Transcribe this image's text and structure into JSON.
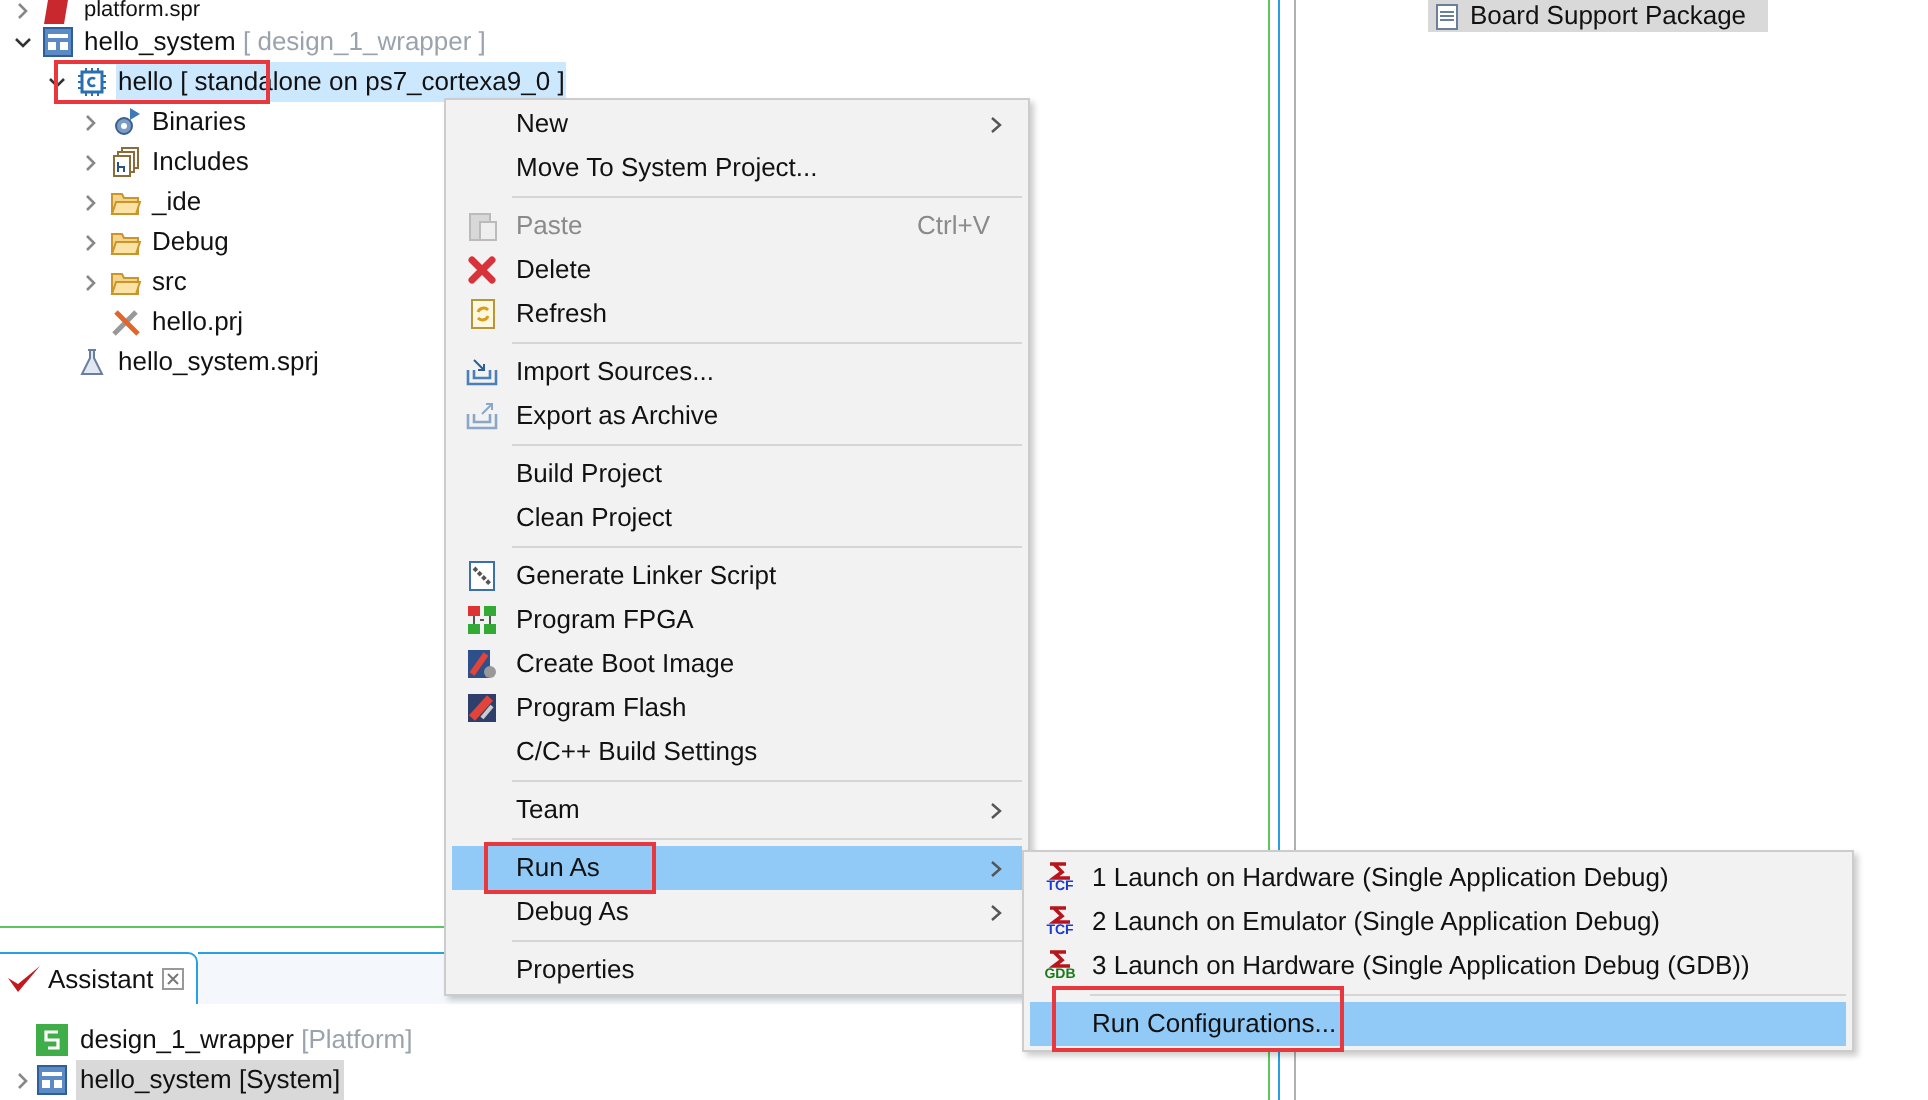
{
  "project_tree": [
    {
      "label": "platform.spr",
      "expanded": false,
      "selected": false,
      "highlighted": false
    },
    {
      "label": "hello_system",
      "suffix": "[ design_1_wrapper ]",
      "expanded": true,
      "selected": false,
      "highlighted": false,
      "children": [
        {
          "label": "hello [ standalone on ps7_cortexa9_0 ]",
          "expanded": true,
          "selected": true,
          "highlighted": true,
          "children": [
            {
              "label": "Binaries",
              "expanded": false,
              "selected": false,
              "highlighted": false
            },
            {
              "label": "Includes",
              "expanded": false,
              "selected": false,
              "highlighted": false
            },
            {
              "label": "_ide",
              "expanded": false,
              "selected": false,
              "highlighted": false
            },
            {
              "label": "Debug",
              "expanded": false,
              "selected": false,
              "highlighted": false
            },
            {
              "label": "src",
              "expanded": false,
              "selected": false,
              "highlighted": false
            },
            {
              "label": "hello.prj",
              "selected": false,
              "highlighted": false
            }
          ]
        },
        {
          "label": "hello_system.sprj",
          "selected": false,
          "highlighted": false
        }
      ]
    }
  ],
  "right_panel": {
    "item": "Board Support Package"
  },
  "context_menu": {
    "items": [
      {
        "kind": "item",
        "label": "New",
        "submenu": true,
        "disabled": false,
        "selected": false,
        "highlighted": false
      },
      {
        "kind": "item",
        "label": "Move To System Project...",
        "submenu": false,
        "disabled": false,
        "selected": false,
        "highlighted": false
      },
      {
        "kind": "separator"
      },
      {
        "kind": "item",
        "label": "Paste",
        "shortcut": "Ctrl+V",
        "submenu": false,
        "disabled": true,
        "selected": false,
        "highlighted": false
      },
      {
        "kind": "item",
        "label": "Delete",
        "submenu": false,
        "disabled": false,
        "selected": false,
        "highlighted": false
      },
      {
        "kind": "item",
        "label": "Refresh",
        "submenu": false,
        "disabled": false,
        "selected": false,
        "highlighted": false
      },
      {
        "kind": "separator"
      },
      {
        "kind": "item",
        "label": "Import Sources...",
        "submenu": false,
        "disabled": false,
        "selected": false,
        "highlighted": false
      },
      {
        "kind": "item",
        "label": "Export as Archive",
        "submenu": false,
        "disabled": false,
        "selected": false,
        "highlighted": false
      },
      {
        "kind": "separator"
      },
      {
        "kind": "item",
        "label": "Build Project",
        "submenu": false,
        "disabled": false,
        "selected": false,
        "highlighted": false
      },
      {
        "kind": "item",
        "label": "Clean Project",
        "submenu": false,
        "disabled": false,
        "selected": false,
        "highlighted": false
      },
      {
        "kind": "separator"
      },
      {
        "kind": "item",
        "label": "Generate Linker Script",
        "submenu": false,
        "disabled": false,
        "selected": false,
        "highlighted": false
      },
      {
        "kind": "item",
        "label": "Program FPGA",
        "submenu": false,
        "disabled": false,
        "selected": false,
        "highlighted": false
      },
      {
        "kind": "item",
        "label": "Create Boot Image",
        "submenu": false,
        "disabled": false,
        "selected": false,
        "highlighted": false
      },
      {
        "kind": "item",
        "label": "Program Flash",
        "submenu": false,
        "disabled": false,
        "selected": false,
        "highlighted": false
      },
      {
        "kind": "item",
        "label": "C/C++ Build Settings",
        "submenu": false,
        "disabled": false,
        "selected": false,
        "highlighted": false
      },
      {
        "kind": "separator"
      },
      {
        "kind": "item",
        "label": "Team",
        "submenu": true,
        "disabled": false,
        "selected": false,
        "highlighted": false
      },
      {
        "kind": "separator"
      },
      {
        "kind": "item",
        "label": "Run As",
        "submenu": true,
        "disabled": false,
        "selected": true,
        "highlighted": true
      },
      {
        "kind": "item",
        "label": "Debug As",
        "submenu": true,
        "disabled": false,
        "selected": false,
        "highlighted": false
      },
      {
        "kind": "separator"
      },
      {
        "kind": "item",
        "label": "Properties",
        "submenu": false,
        "disabled": false,
        "selected": false,
        "highlighted": false
      }
    ]
  },
  "run_as_submenu": {
    "items": [
      {
        "kind": "item",
        "label": "1 Launch on Hardware (Single Application Debug)",
        "icon_caption": "TCF",
        "selected": false,
        "highlighted": false
      },
      {
        "kind": "item",
        "label": "2 Launch on Emulator (Single Application Debug)",
        "icon_caption": "TCF",
        "selected": false,
        "highlighted": false
      },
      {
        "kind": "item",
        "label": "3 Launch on Hardware (Single Application Debug (GDB))",
        "icon_caption": "GDB",
        "selected": false,
        "highlighted": false
      },
      {
        "kind": "separator"
      },
      {
        "kind": "item",
        "label": "Run Configurations...",
        "selected": true,
        "highlighted": true
      }
    ]
  },
  "assistant": {
    "tab": {
      "label": "Assistant"
    },
    "items": [
      {
        "label": "design_1_wrapper",
        "suffix": "[Platform]",
        "selected": false
      },
      {
        "label": "hello_system",
        "suffix": "[System]",
        "selected": true,
        "expanded": false
      }
    ]
  }
}
